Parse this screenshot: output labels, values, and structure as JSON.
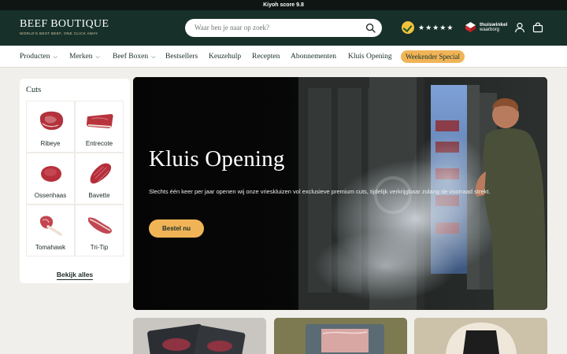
{
  "announcement": {
    "text": "Kiyoh score 9.8"
  },
  "header": {
    "logo_title": "BEEF BOUTIQUE",
    "logo_tagline": "WORLD'S BEST BEEF, ONE CLICK AWAY",
    "search_placeholder": "Waar ben je naar op zoek?",
    "rating_stars": 5,
    "thuiswinkel_line1": "thuiswinkel",
    "thuiswinkel_line2": "waarborg",
    "icons": [
      "search-icon",
      "user-icon",
      "cart-icon"
    ]
  },
  "nav": {
    "items": [
      {
        "label": "Producten",
        "dropdown": true
      },
      {
        "label": "Merken",
        "dropdown": true
      },
      {
        "label": "Beef Boxen",
        "dropdown": true
      },
      {
        "label": "Bestsellers",
        "dropdown": false
      },
      {
        "label": "Keuzehulp",
        "dropdown": false
      },
      {
        "label": "Recepten",
        "dropdown": false
      },
      {
        "label": "Abonnementen",
        "dropdown": false
      },
      {
        "label": "Kluis Opening",
        "dropdown": false
      }
    ],
    "special": "Weekender Special"
  },
  "cuts": {
    "title": "Cuts",
    "items": [
      {
        "label": "Ribeye"
      },
      {
        "label": "Entrecote"
      },
      {
        "label": "Ossenhaas"
      },
      {
        "label": "Bavette"
      },
      {
        "label": "Tomahawk"
      },
      {
        "label": "Tri-Tip"
      }
    ],
    "see_all": "Bekijk alles"
  },
  "hero": {
    "title": "Kluis Opening",
    "subtitle": "Slechts één keer per jaar openen wij onze vrieskluizen vol exclusieve premium cuts, tijdelijk verkrijgbaar zolang de voorraad strekt.",
    "button": "Bestel nu"
  },
  "colors": {
    "header_bg": "#17302a",
    "accent": "#f0b457",
    "page_bg": "#f1efeb"
  }
}
